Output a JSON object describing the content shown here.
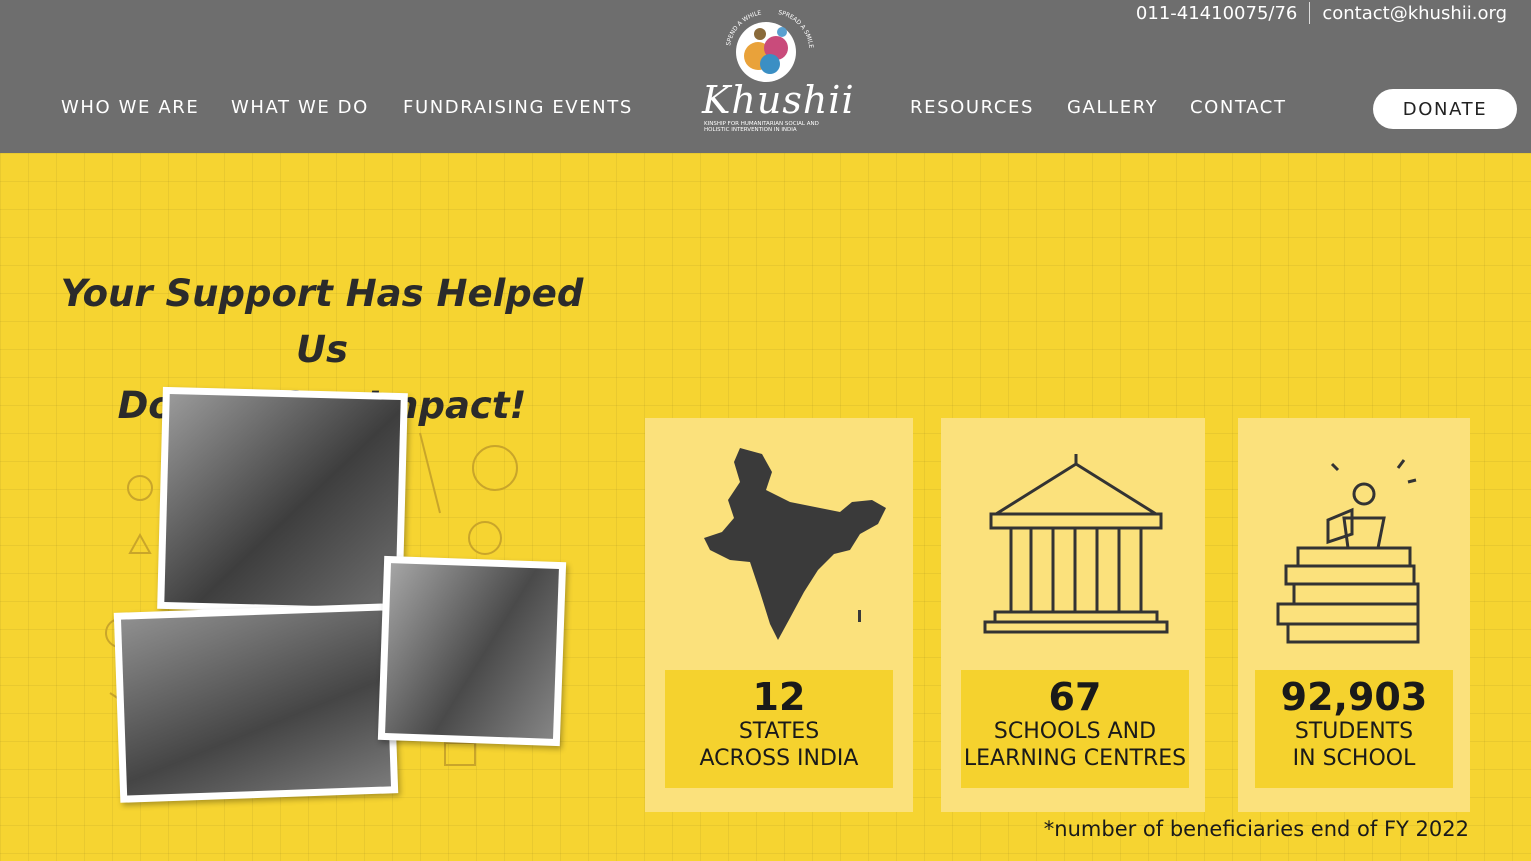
{
  "header": {
    "phone": "011-41410075/76",
    "email": "contact@khushii.org",
    "nav_left": [
      "WHO WE ARE",
      "WHAT WE DO",
      "FUNDRAISING EVENTS"
    ],
    "nav_right": [
      "RESOURCES",
      "GALLERY",
      "CONTACT"
    ],
    "donate_label": "DONATE",
    "logo": {
      "word": "Khushii",
      "arc_left": "SPEND A WHILE",
      "arc_right": "SPREAD A SMILE",
      "subtitle": "KINSHIP FOR HUMANITARIAN SOCIAL AND HOLISTIC INTERVENTION IN INDIA"
    }
  },
  "hero": {
    "heading_line1": "Your Support Has Helped Us",
    "heading_line2": "Double Our Impact!",
    "stats": [
      {
        "number": "12",
        "label_line1": "STATES",
        "label_line2": "ACROSS INDIA",
        "icon": "india-map-icon"
      },
      {
        "number": "67",
        "label_line1": "SCHOOLS AND",
        "label_line2": "LEARNING CENTRES",
        "icon": "school-building-icon"
      },
      {
        "number": "92,903",
        "label_line1": "STUDENTS",
        "label_line2": "IN SCHOOL",
        "icon": "student-books-icon"
      }
    ],
    "footnote": "*number of beneficiaries end of FY 2022"
  },
  "colors": {
    "header_bg": "#6e6e6e",
    "hero_bg": "#f6d431",
    "card_bg": "#fbe17c"
  }
}
